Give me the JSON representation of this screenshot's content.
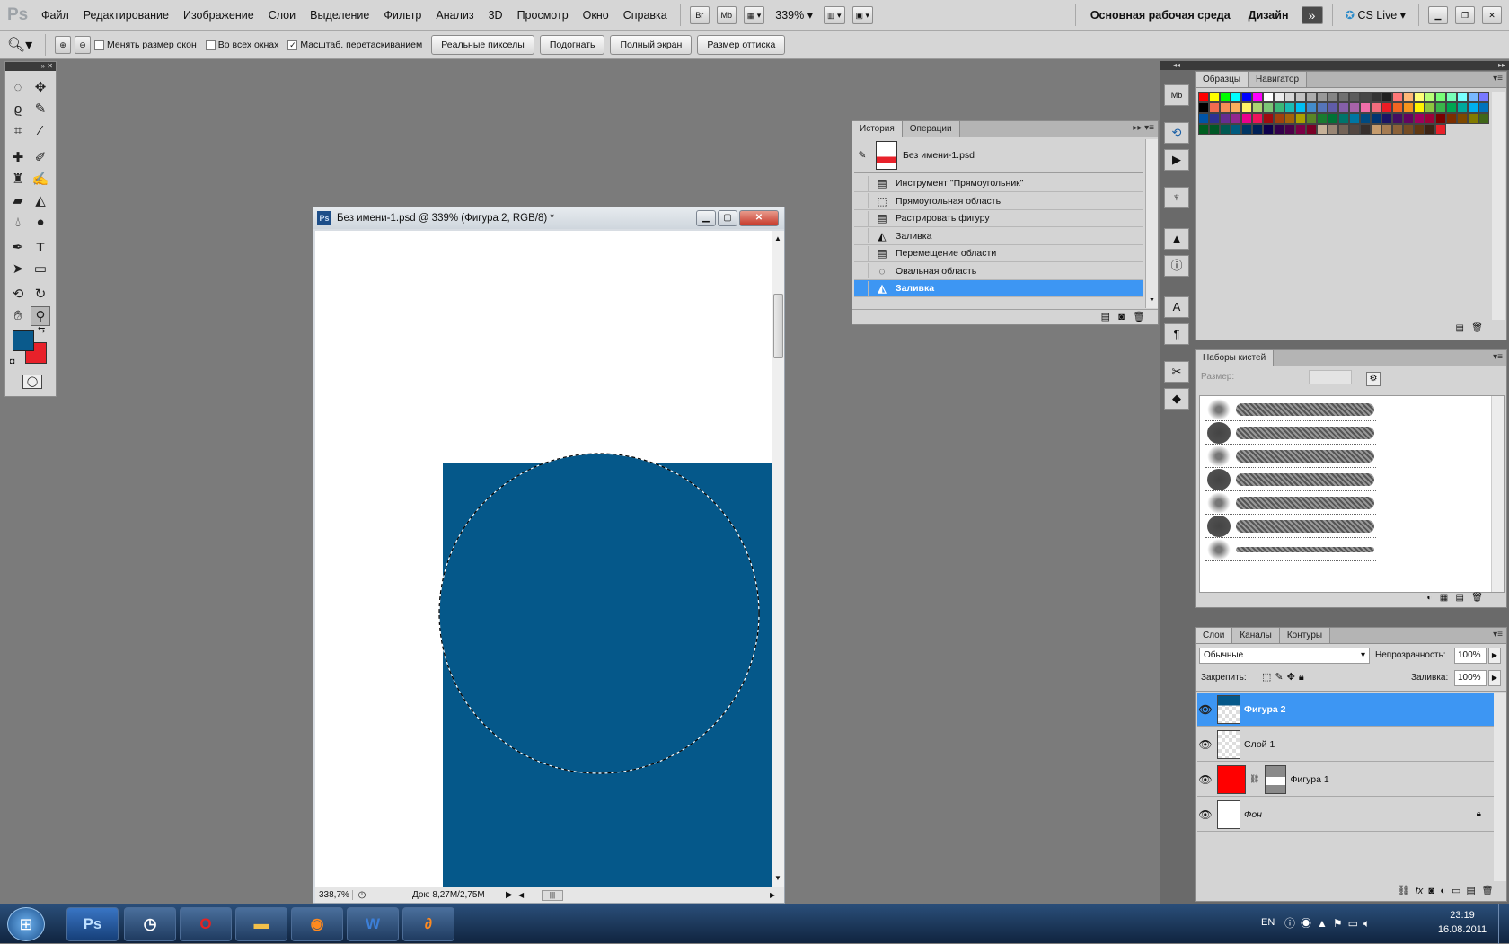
{
  "menubar": {
    "logo": "Ps",
    "items": [
      "Файл",
      "Редактирование",
      "Изображение",
      "Слои",
      "Выделение",
      "Фильтр",
      "Анализ",
      "3D",
      "Просмотр",
      "Окно",
      "Справка"
    ],
    "br": "Br",
    "mb": "Mb",
    "zoom": "339%",
    "workspace": "Основная рабочая среда",
    "design": "Дизайн",
    "more": "»",
    "cslive": "CS Live"
  },
  "options": {
    "resize_windows": "Менять размер окон",
    "all_windows": "Во всех окнах",
    "scrubby_zoom": "Масштаб. перетаскиванием",
    "actual_pixels": "Реальные пикселы",
    "fit_screen": "Подогнать",
    "fill_screen": "Полный экран",
    "print_size": "Размер оттиска"
  },
  "colors": {
    "foreground": "#0a5a8c",
    "background": "#e8212a",
    "shape": "#05588a",
    "selection": "#3d96f3"
  },
  "document": {
    "title": "Без имени-1.psd @ 339% (Фигура 2, RGB/8) *",
    "zoom": "338,7%",
    "doc_size": "Док: 8,27M/2,75M"
  },
  "history": {
    "tabs": [
      "История",
      "Операции"
    ],
    "snapshot": "Без имени-1.psd",
    "steps": [
      {
        "label": "Инструмент \"Прямоугольник\"",
        "icon": "▤"
      },
      {
        "label": "Прямоугольная область",
        "icon": "⬚"
      },
      {
        "label": "Растрировать фигуру",
        "icon": "▤"
      },
      {
        "label": "Заливка",
        "icon": "◭"
      },
      {
        "label": "Перемещение области",
        "icon": "▤"
      },
      {
        "label": "Овальная область",
        "icon": "◌"
      },
      {
        "label": "Заливка",
        "icon": "◭"
      }
    ]
  },
  "swatches": {
    "tabs": [
      "Образцы",
      "Навигатор"
    ],
    "colors": [
      "#ff0000",
      "#ffff00",
      "#00ff00",
      "#00ffff",
      "#0000ff",
      "#ff00ff",
      "#ffffff",
      "#ebebeb",
      "#d6d6d6",
      "#c2c2c2",
      "#adadad",
      "#999999",
      "#858585",
      "#707070",
      "#5c5c5c",
      "#474747",
      "#333333",
      "#1f1f1f",
      "#ff7878",
      "#ffb878",
      "#ffff78",
      "#b8ff78",
      "#78ff78",
      "#78ffb8",
      "#78ffff",
      "#78b8ff",
      "#7878ff",
      "#000000",
      "#f26c4f",
      "#f68e55",
      "#fbaf5c",
      "#fff467",
      "#acd372",
      "#7cc576",
      "#3bb878",
      "#1abbb4",
      "#00bff3",
      "#438ccb",
      "#5574b9",
      "#605ca8",
      "#855fa8",
      "#a763a8",
      "#f06ea9",
      "#f26d7d",
      "#ed1c24",
      "#f26522",
      "#f7941d",
      "#fff200",
      "#8dc63f",
      "#39b54a",
      "#00a651",
      "#00a99d",
      "#00aeef",
      "#0072bc",
      "#0054a6",
      "#2e3192",
      "#662d91",
      "#92278f",
      "#ec008c",
      "#ed145b",
      "#9e0b0f",
      "#a0410d",
      "#a36209",
      "#aba000",
      "#598527",
      "#197b30",
      "#007236",
      "#00746b",
      "#0076a3",
      "#004a80",
      "#003471",
      "#1b1464",
      "#440e62",
      "#630460",
      "#9e005d",
      "#9e0039",
      "#790000",
      "#7b2e00",
      "#7d4900",
      "#827b00",
      "#406618",
      "#005e20",
      "#005826",
      "#005952",
      "#005b7f",
      "#003663",
      "#002157",
      "#0d004c",
      "#32004b",
      "#4b0049",
      "#7b0046",
      "#7a0026",
      "#c7b299",
      "#998675",
      "#736357",
      "#534741",
      "#37302d",
      "#c69c6d",
      "#a67c52",
      "#8c6239",
      "#754c24",
      "#603913",
      "#3c2415",
      "#e8212a"
    ]
  },
  "brushes": {
    "title": "Наборы кистей",
    "size_label": "Размер:"
  },
  "layers": {
    "tabs": [
      "Слои",
      "Каналы",
      "Контуры"
    ],
    "blend_mode": "Обычные",
    "opacity_label": "Непрозрачность:",
    "opacity": "100%",
    "lock_label": "Закрепить:",
    "fill_label": "Заливка:",
    "fill": "100%",
    "items": [
      {
        "name": "Фигура 2",
        "selected": true
      },
      {
        "name": "Слой 1",
        "selected": false
      },
      {
        "name": "Фигура 1",
        "selected": false
      },
      {
        "name": "Фон",
        "selected": false
      }
    ]
  },
  "taskbar": {
    "lang": "EN",
    "time": "23:19",
    "date": "16.08.2011"
  }
}
